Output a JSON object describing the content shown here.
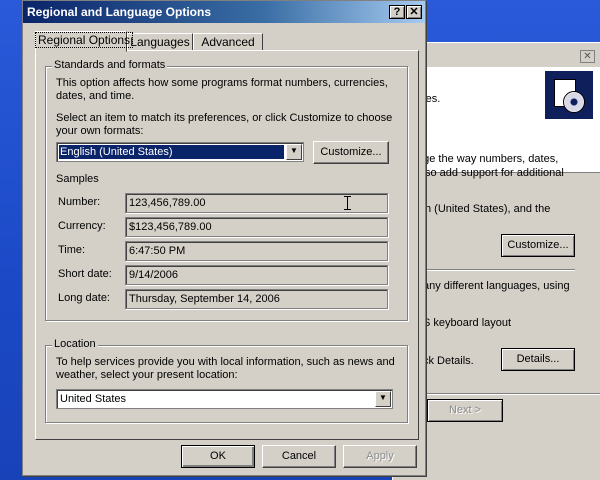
{
  "dialog": {
    "title": "Regional and Language Options",
    "help_btn": "?",
    "close_btn": "✕",
    "tabs": [
      {
        "label": "Regional Options"
      },
      {
        "label": "Languages"
      },
      {
        "label": "Advanced"
      }
    ],
    "standards": {
      "group_title": "Standards and formats",
      "description": "This option affects how some programs format numbers, currencies, dates, and time.",
      "instruction": "Select an item to match its preferences, or click Customize to choose your own formats:",
      "format_value": "English (United States)",
      "customize_label": "Customize...",
      "samples_heading": "Samples",
      "samples": [
        {
          "label": "Number:",
          "value": "123,456,789.00"
        },
        {
          "label": "Currency:",
          "value": "$123,456,789.00"
        },
        {
          "label": "Time:",
          "value": "6:47:50 PM"
        },
        {
          "label": "Short date:",
          "value": "9/14/2006"
        },
        {
          "label": "Long date:",
          "value": "Thursday, September 14, 2006"
        }
      ]
    },
    "location": {
      "group_title": "Location",
      "description": "To help services provide you with local information, such as news and weather, select your present location:",
      "value": "United States"
    },
    "footer": {
      "ok": "OK",
      "cancel": "Cancel",
      "apply": "Apply"
    }
  },
  "background_window": {
    "close_btn": "✕",
    "fragments": {
      "line1": "nguages.",
      "line2": "nge the way numbers, dates,",
      "line3": "so add support for additional",
      "line4": "h (United States), and the",
      "line5": "any different languages, using",
      "line6": "S keyboard layout",
      "line7": "ck Details."
    },
    "customize_label": "Customize...",
    "details_label": "Details...",
    "next_label": "Next >"
  }
}
